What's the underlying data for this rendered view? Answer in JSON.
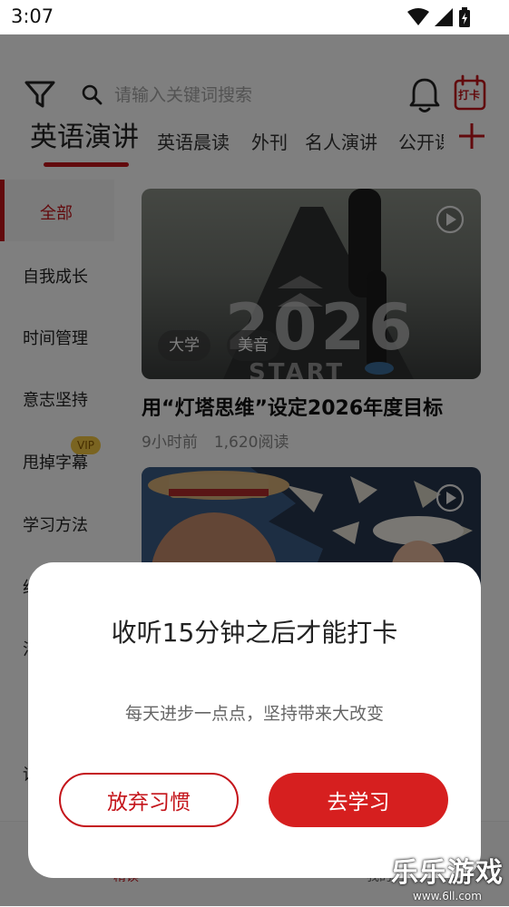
{
  "status_bar": {
    "time": "3:07"
  },
  "header": {
    "search_placeholder": "请输入关键词搜索",
    "checkin_label": "打卡"
  },
  "tabs": [
    "英语演讲",
    "英语晨读",
    "外刊",
    "名人演讲",
    "公开课"
  ],
  "sidebar": {
    "items": [
      "全部",
      "自我成长",
      "时间管理",
      "意志坚持",
      "甩掉字幕",
      "学习方法",
      "经",
      "污",
      "读"
    ],
    "vip_badge": "VIP"
  },
  "cards": [
    {
      "image_text": "2026",
      "image_subtext": "START",
      "tags": [
        "大学",
        "美音"
      ],
      "title": "用“灯塔思维”设定2026年度目标",
      "time": "9小时前",
      "reads": "1,620阅读"
    },
    {
      "image_text": "",
      "tags": []
    }
  ],
  "bottom_nav": {
    "left_label": "精读",
    "right_label": "我的"
  },
  "dialog": {
    "title": "收听15分钟之后才能打卡",
    "message": "每天进步一点点，坚持带来大改变",
    "quit_button": "放弃习惯",
    "study_button": "去学习"
  },
  "watermark": {
    "logo": "乐乐游戏",
    "url": "www.6ll.com"
  },
  "colors": {
    "accent": "#c4141a",
    "primary_button": "#d61f1f",
    "overlay": "#000000"
  }
}
